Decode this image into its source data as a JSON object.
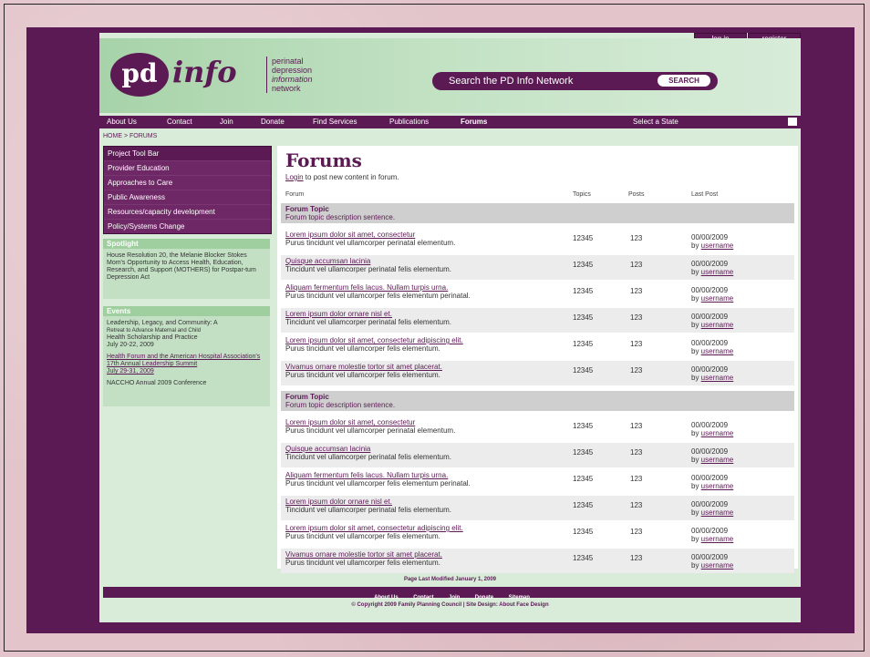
{
  "brand": {
    "logo_pd": "pd",
    "logo_info": "info",
    "tagline": [
      "perinatal",
      "depression",
      "information",
      "network"
    ],
    "brand_color": "#5c1a55"
  },
  "header": {
    "login_label": "log in",
    "register_label": "register",
    "search_label": "Search the PD Info Network",
    "search_button": "SEARCH"
  },
  "nav": {
    "items": [
      "About Us",
      "Contact",
      "Join",
      "Donate",
      "Find Services",
      "Publications",
      "Forums"
    ],
    "active": "Forums",
    "state_select": "Select a State"
  },
  "breadcrumb": "HOME > FORUMS",
  "sidebar": {
    "toolbar_title": "Project Tool Bar",
    "toolbar_items": [
      "Provider Education",
      "Approaches to Care",
      "Public Awareness",
      "Resources/capacity development",
      "Policy/Systems Change"
    ],
    "spotlight_title": "Spotlight",
    "spotlight_text": "House Resolution 20, the Melanie Blocker Stokes Mom's Opportunity to Access Health, Education, Research, and Support (MOTHERS) for Postpar-tum Depression Act",
    "events_title": "Events",
    "events": {
      "e1_title": "Leadership, Legacy, and Community: A",
      "e1_sub": "Retreat to Advance Maternal and Child",
      "e1_rest": "Health Scholarship and Practice",
      "e1_date": "July 20-22, 2009",
      "e2_link": "Health Forum and the American Hospital Association's 17th Annual Leadership Summit",
      "e2_date": "July 29-31, 2009",
      "e3": "NACCHO Annual 2009 Conference"
    }
  },
  "main": {
    "title": "Forums",
    "login_link": "Login",
    "login_text": " to post new content in forum.",
    "columns": {
      "forum": "Forum",
      "topics": "Topics",
      "posts": "Posts",
      "last_post": "Last Post"
    },
    "sections": [
      {
        "topic": "Forum Topic",
        "topic_desc": "Forum topic description sentence.",
        "rows": [
          {
            "title": "Lorem ipsum dolor sit amet, consectetur",
            "desc": "Purus tincidunt vel ullamcorper perinatal elementum.",
            "topics": "12345",
            "posts": "123",
            "date": "00/00/2009",
            "by": "by ",
            "user": "username"
          },
          {
            "title": "Quisque accumsan lacinia",
            "desc": "Tincidunt vel ullamcorper perinatal felis elementum.",
            "topics": "12345",
            "posts": "123",
            "date": "00/00/2009",
            "by": "by ",
            "user": "username"
          },
          {
            "title": "Aliquam fermentum felis lacus. Nullam turpis urna.",
            "desc": "Purus tincidunt vel ullamcorper felis elementum perinatal.",
            "topics": "12345",
            "posts": "123",
            "date": "00/00/2009",
            "by": "by ",
            "user": "username"
          },
          {
            "title": "Lorem ipsum dolor ornare nisl et.",
            "desc": "Tincidunt vel ullamcorper perinatal felis elementum.",
            "topics": "12345",
            "posts": "123",
            "date": "00/00/2009",
            "by": "by ",
            "user": "username"
          },
          {
            "title": "Lorem ipsum dolor sit amet, consectetur adipiscing elit.",
            "desc": "Purus tincidunt vel ullamcorper felis elementum.",
            "topics": "12345",
            "posts": "123",
            "date": "00/00/2009",
            "by": "by ",
            "user": "username"
          },
          {
            "title": "Vivamus ornare molestie tortor sit amet placerat.",
            "desc": "Purus tincidunt vel ullamcorper felis elementum.",
            "topics": "12345",
            "posts": "123",
            "date": "00/00/2009",
            "by": "by ",
            "user": "username"
          }
        ]
      },
      {
        "topic": "Forum Topic",
        "topic_desc": "Forum topic description sentence.",
        "rows": [
          {
            "title": "Lorem ipsum dolor sit amet, consectetur",
            "desc": "Purus tincidunt vel ullamcorper perinatal elementum.",
            "topics": "12345",
            "posts": "123",
            "date": "00/00/2009",
            "by": "by ",
            "user": "username"
          },
          {
            "title": "Quisque accumsan lacinia",
            "desc": "Tincidunt vel ullamcorper perinatal felis elementum.",
            "topics": "12345",
            "posts": "123",
            "date": "00/00/2009",
            "by": "by ",
            "user": "username"
          },
          {
            "title": "Aliquam fermentum felis lacus. Nullam turpis urna.",
            "desc": "Purus tincidunt vel ullamcorper felis elementum perinatal.",
            "topics": "12345",
            "posts": "123",
            "date": "00/00/2009",
            "by": "by ",
            "user": "username"
          },
          {
            "title": "Lorem ipsum dolor ornare nisl et.",
            "desc": "Tincidunt vel ullamcorper perinatal felis elementum.",
            "topics": "12345",
            "posts": "123",
            "date": "00/00/2009",
            "by": "by ",
            "user": "username"
          },
          {
            "title": "Lorem ipsum dolor sit amet, consectetur adipiscing elit.",
            "desc": "Purus tincidunt vel ullamcorper felis elementum.",
            "topics": "12345",
            "posts": "123",
            "date": "00/00/2009",
            "by": "by ",
            "user": "username"
          },
          {
            "title": "Vivamus ornare molestie tortor sit amet placerat.",
            "desc": "Purus tincidunt vel ullamcorper felis elementum.",
            "topics": "12345",
            "posts": "123",
            "date": "00/00/2009",
            "by": "by ",
            "user": "username"
          }
        ]
      }
    ]
  },
  "footer": {
    "modified": "Page Last Modified January 1, 2009",
    "links": [
      "About Us",
      "Contact",
      "Join",
      "Donate",
      "Sitemap"
    ],
    "copyright": "© Copyright 2009 Family Planning Council    |    Site Design: About Face Design"
  }
}
